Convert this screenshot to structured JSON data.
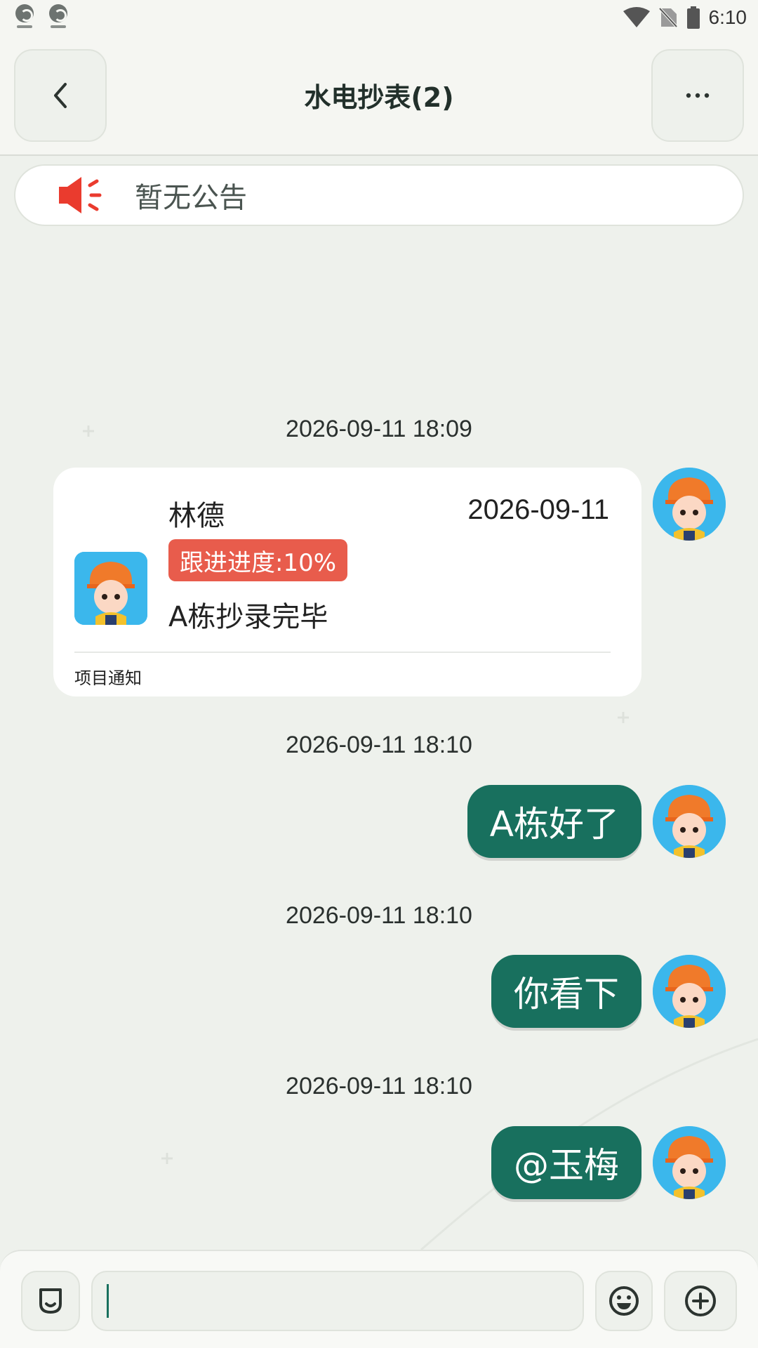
{
  "status_bar": {
    "time": "6:10",
    "icons": [
      "app-notification-icon",
      "app-notification-icon",
      "wifi-icon",
      "no-sim-icon",
      "battery-icon"
    ]
  },
  "header": {
    "title": "水电抄表(2)",
    "back_icon": "chevron-left-icon",
    "more_icon": "ellipsis-icon"
  },
  "notice": {
    "icon": "megaphone-icon",
    "text": "暂无公告",
    "icon_color": "#ea3b2e"
  },
  "messages": [
    {
      "type": "card",
      "timestamp": "2026-09-11 18:09",
      "card": {
        "name": "林德",
        "date": "2026-09-11",
        "progress": "跟进进度:10%",
        "content": "A栋抄录完毕",
        "footer": "项目通知"
      }
    },
    {
      "type": "text",
      "timestamp": "2026-09-11 18:10",
      "text": "A栋好了"
    },
    {
      "type": "text",
      "timestamp": "2026-09-11 18:10",
      "text": "你看下"
    },
    {
      "type": "text",
      "timestamp": "2026-09-11 18:10",
      "text": "@玉梅"
    }
  ],
  "input_bar": {
    "voice_icon": "voice-toggle-icon",
    "input_value": "",
    "emoji_icon": "emoji-icon",
    "plus_icon": "plus-circle-icon"
  },
  "colors": {
    "accent": "#18705e",
    "progress_badge": "#e85c4c",
    "background": "#eef1ec",
    "avatar_bg": "#3bb7ec"
  }
}
